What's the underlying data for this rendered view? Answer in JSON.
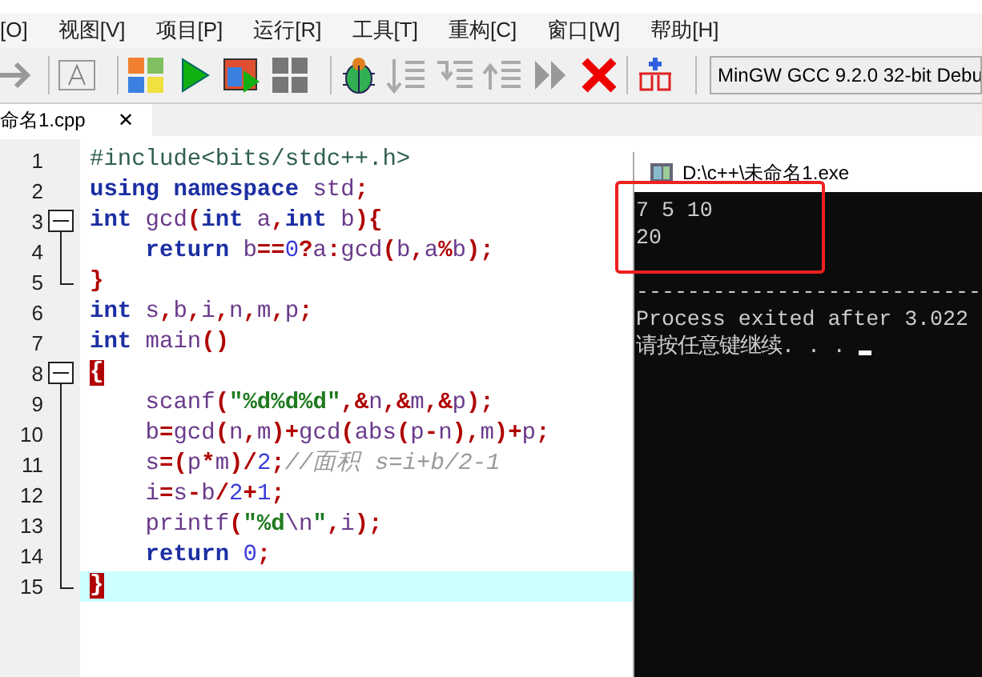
{
  "menu": [
    "[O]",
    "视图[V]",
    "项目[P]",
    "运行[R]",
    "工具[T]",
    "重构[C]",
    "窗口[W]",
    "帮助[H]"
  ],
  "toolbar": {
    "compiler": "MinGW GCC 9.2.0 32-bit Debu"
  },
  "tabs": [
    {
      "label": "命名1.cpp",
      "close": "✕",
      "selected": true
    }
  ],
  "editor": {
    "lines": [
      {
        "number": "1",
        "current": false,
        "tokens": [
          {
            "kind": "pre",
            "text": "#include<bits/stdc++.h>"
          }
        ]
      },
      {
        "number": "2",
        "current": false,
        "tokens": [
          {
            "kind": "kw",
            "text": "using"
          },
          {
            "kind": "kw",
            "text": " namespace"
          },
          {
            "kind": "id",
            "text": " std"
          },
          {
            "kind": "p",
            "text": ";"
          }
        ]
      },
      {
        "number": "3",
        "current": false,
        "fold": {
          "kind": "start"
        },
        "tokens": [
          {
            "kind": "kw",
            "text": "int"
          },
          {
            "kind": "id",
            "text": " gcd"
          },
          {
            "kind": "p",
            "text": "("
          },
          {
            "kind": "kw",
            "text": "int"
          },
          {
            "kind": "id",
            "text": " a"
          },
          {
            "kind": "p",
            "text": ","
          },
          {
            "kind": "kw",
            "text": "int"
          },
          {
            "kind": "id",
            "text": " b"
          },
          {
            "kind": "p",
            "text": "){"
          }
        ]
      },
      {
        "number": "4",
        "current": false,
        "fold": {
          "kind": "line"
        },
        "tokens": [
          {
            "kind": "kw",
            "text": "    return"
          },
          {
            "kind": "id",
            "text": " b"
          },
          {
            "kind": "p",
            "text": "=="
          },
          {
            "kind": "num",
            "text": "0"
          },
          {
            "kind": "p",
            "text": "?"
          },
          {
            "kind": "id",
            "text": "a"
          },
          {
            "kind": "p",
            "text": ":"
          },
          {
            "kind": "id",
            "text": "gcd"
          },
          {
            "kind": "p",
            "text": "("
          },
          {
            "kind": "id",
            "text": "b"
          },
          {
            "kind": "p",
            "text": ","
          },
          {
            "kind": "id",
            "text": "a"
          },
          {
            "kind": "p",
            "text": "%"
          },
          {
            "kind": "id",
            "text": "b"
          },
          {
            "kind": "p",
            "text": ");"
          }
        ]
      },
      {
        "number": "5",
        "current": false,
        "fold": {
          "kind": "end"
        },
        "tokens": [
          {
            "kind": "p",
            "text": "}"
          }
        ]
      },
      {
        "number": "6",
        "current": false,
        "tokens": [
          {
            "kind": "kw",
            "text": "int"
          },
          {
            "kind": "id",
            "text": " s"
          },
          {
            "kind": "p",
            "text": ","
          },
          {
            "kind": "id",
            "text": "b"
          },
          {
            "kind": "p",
            "text": ","
          },
          {
            "kind": "id",
            "text": "i"
          },
          {
            "kind": "p",
            "text": ","
          },
          {
            "kind": "id",
            "text": "n"
          },
          {
            "kind": "p",
            "text": ","
          },
          {
            "kind": "id",
            "text": "m"
          },
          {
            "kind": "p",
            "text": ","
          },
          {
            "kind": "id",
            "text": "p"
          },
          {
            "kind": "p",
            "text": ";"
          }
        ]
      },
      {
        "number": "7",
        "current": false,
        "tokens": [
          {
            "kind": "kw",
            "text": "int"
          },
          {
            "kind": "id",
            "text": " main"
          },
          {
            "kind": "p",
            "text": "()"
          }
        ]
      },
      {
        "number": "8",
        "current": false,
        "fold": {
          "kind": "start"
        },
        "tokens": [
          {
            "kind": "match",
            "text": "{"
          }
        ]
      },
      {
        "number": "9",
        "current": false,
        "fold": {
          "kind": "line"
        },
        "tokens": [
          {
            "kind": "id",
            "text": "    scanf"
          },
          {
            "kind": "p",
            "text": "("
          },
          {
            "kind": "str",
            "text": "\"%d%d%d\""
          },
          {
            "kind": "p",
            "text": ",&"
          },
          {
            "kind": "id",
            "text": "n"
          },
          {
            "kind": "p",
            "text": ",&"
          },
          {
            "kind": "id",
            "text": "m"
          },
          {
            "kind": "p",
            "text": ",&"
          },
          {
            "kind": "id",
            "text": "p"
          },
          {
            "kind": "p",
            "text": ");"
          }
        ]
      },
      {
        "number": "10",
        "current": false,
        "fold": {
          "kind": "line"
        },
        "tokens": [
          {
            "kind": "id",
            "text": "    b"
          },
          {
            "kind": "p",
            "text": "="
          },
          {
            "kind": "id",
            "text": "gcd"
          },
          {
            "kind": "p",
            "text": "("
          },
          {
            "kind": "id",
            "text": "n"
          },
          {
            "kind": "p",
            "text": ","
          },
          {
            "kind": "id",
            "text": "m"
          },
          {
            "kind": "p",
            "text": ")+"
          },
          {
            "kind": "id",
            "text": "gcd"
          },
          {
            "kind": "p",
            "text": "("
          },
          {
            "kind": "id",
            "text": "abs"
          },
          {
            "kind": "p",
            "text": "("
          },
          {
            "kind": "id",
            "text": "p"
          },
          {
            "kind": "p",
            "text": "-"
          },
          {
            "kind": "id",
            "text": "n"
          },
          {
            "kind": "p",
            "text": "),"
          },
          {
            "kind": "id",
            "text": "m"
          },
          {
            "kind": "p",
            "text": ")+"
          },
          {
            "kind": "id",
            "text": "p"
          },
          {
            "kind": "p",
            "text": ";"
          }
        ]
      },
      {
        "number": "11",
        "current": false,
        "fold": {
          "kind": "line"
        },
        "tokens": [
          {
            "kind": "id",
            "text": "    s"
          },
          {
            "kind": "p",
            "text": "=("
          },
          {
            "kind": "id",
            "text": "p"
          },
          {
            "kind": "p",
            "text": "*"
          },
          {
            "kind": "id",
            "text": "m"
          },
          {
            "kind": "p",
            "text": ")/"
          },
          {
            "kind": "num",
            "text": "2"
          },
          {
            "kind": "p",
            "text": ";"
          },
          {
            "kind": "cmt",
            "text": "//面积 s=i+b/2-1"
          }
        ]
      },
      {
        "number": "12",
        "current": false,
        "fold": {
          "kind": "line"
        },
        "tokens": [
          {
            "kind": "id",
            "text": "    i"
          },
          {
            "kind": "p",
            "text": "="
          },
          {
            "kind": "id",
            "text": "s"
          },
          {
            "kind": "p",
            "text": "-"
          },
          {
            "kind": "id",
            "text": "b"
          },
          {
            "kind": "p",
            "text": "/"
          },
          {
            "kind": "num",
            "text": "2"
          },
          {
            "kind": "p",
            "text": "+"
          },
          {
            "kind": "num",
            "text": "1"
          },
          {
            "kind": "p",
            "text": ";"
          }
        ]
      },
      {
        "number": "13",
        "current": false,
        "fold": {
          "kind": "line"
        },
        "tokens": [
          {
            "kind": "id",
            "text": "    printf"
          },
          {
            "kind": "p",
            "text": "("
          },
          {
            "kind": "str",
            "text": "\"%d"
          },
          {
            "kind": "esc",
            "text": "\\n"
          },
          {
            "kind": "str",
            "text": "\""
          },
          {
            "kind": "p",
            "text": ","
          },
          {
            "kind": "id",
            "text": "i"
          },
          {
            "kind": "p",
            "text": ");"
          }
        ]
      },
      {
        "number": "14",
        "current": false,
        "fold": {
          "kind": "line"
        },
        "tokens": [
          {
            "kind": "kw",
            "text": "    return"
          },
          {
            "kind": "num",
            "text": " 0"
          },
          {
            "kind": "p",
            "text": ";"
          }
        ]
      },
      {
        "number": "15",
        "current": true,
        "fold": {
          "kind": "end"
        },
        "tokens": [
          {
            "kind": "match",
            "text": "}"
          }
        ]
      }
    ]
  },
  "console": {
    "title": "D:\\c++\\未命名1.exe",
    "output": [
      "7 5 10",
      "20"
    ],
    "separator": "---------------------------",
    "status": [
      "Process exited after 3.022",
      "请按任意键继续. . . "
    ],
    "cursor": true
  }
}
